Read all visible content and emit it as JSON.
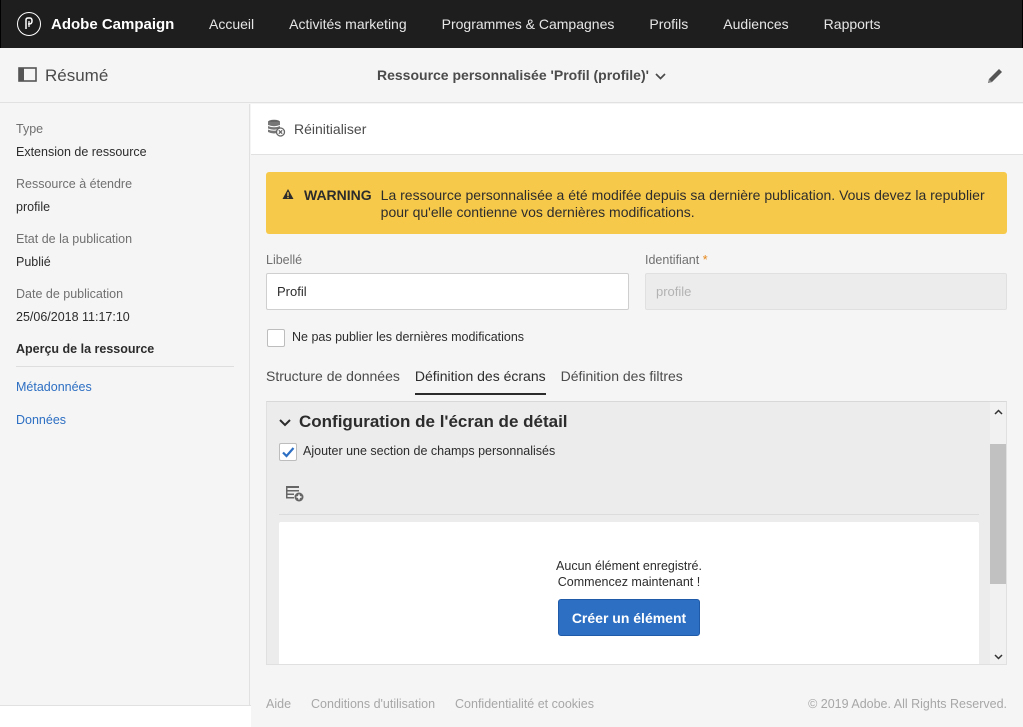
{
  "app": {
    "name": "Adobe Campaign"
  },
  "nav": [
    "Accueil",
    "Activités marketing",
    "Programmes & Campagnes",
    "Profils",
    "Audiences",
    "Rapports"
  ],
  "header": {
    "summary": "Résumé",
    "resource_title": "Ressource personnalisée 'Profil (profile)'"
  },
  "left": {
    "type_label": "Type",
    "type_value": "Extension de ressource",
    "extend_label": "Ressource à étendre",
    "extend_value": "profile",
    "state_label": "Etat de la publication",
    "state_value": "Publié",
    "date_label": "Date de publication",
    "date_value": "25/06/2018 11:17:10",
    "preview_label": "Aperçu de la ressource",
    "links": [
      "Métadonnées",
      "Données"
    ]
  },
  "toolbar": {
    "reset_label": "Réinitialiser"
  },
  "warning": {
    "title": "WARNING",
    "text": "La ressource personnalisée a été modifée depuis sa dernière publication. Vous devez la republier pour qu'elle contienne vos dernières modifications.",
    "color": "#f7c94b"
  },
  "form": {
    "label_field": "Libellé",
    "label_value": "Profil",
    "id_field": "Identifiant",
    "id_required": "*",
    "id_placeholder": "profile",
    "no_publish_label": "Ne pas publier les dernières modifications",
    "no_publish_checked": false
  },
  "tabs": [
    {
      "label": "Structure de données",
      "active": false
    },
    {
      "label": "Définition des écrans",
      "active": true
    },
    {
      "label": "Définition des filtres",
      "active": false
    }
  ],
  "config": {
    "title": "Configuration de l'écran de détail",
    "add_section_label": "Ajouter une section de champs personnalisés",
    "add_section_checked": true,
    "empty_line1": "Aucun élément enregistré.",
    "empty_line2": "Commencez maintenant !",
    "create_label": "Créer un élément"
  },
  "footer": {
    "links": [
      "Aide",
      "Conditions d'utilisation",
      "Confidentialité et cookies"
    ],
    "copyright": "© 2019 Adobe. All Rights Reserved."
  },
  "colors": {
    "topbar": "#1e1e1e",
    "link": "#2d6fc3",
    "button": "#2d6fc3",
    "accent_required": "#e68619"
  }
}
